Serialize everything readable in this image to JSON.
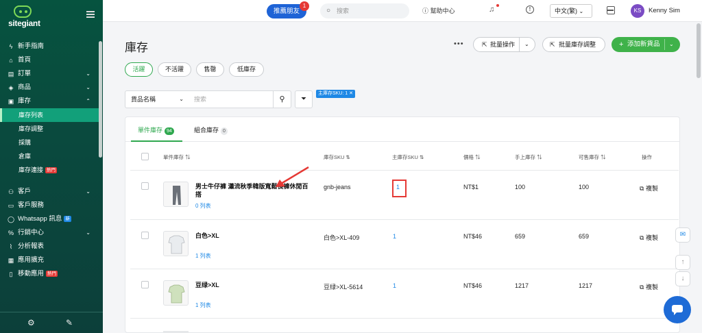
{
  "brand": {
    "name": "sitegiant"
  },
  "sidebar": {
    "items": [
      {
        "label": "新手指南",
        "icon": "bolt-icon"
      },
      {
        "label": "首頁",
        "icon": "home-icon"
      },
      {
        "label": "訂單",
        "icon": "clipboard-icon",
        "chevron": "down"
      },
      {
        "label": "商品",
        "icon": "box-icon",
        "chevron": "down"
      },
      {
        "label": "庫存",
        "icon": "inventory-icon",
        "chevron": "up"
      }
    ],
    "subitems": [
      {
        "label": "庫存列表",
        "active": true
      },
      {
        "label": "庫存調整"
      },
      {
        "label": "採購"
      },
      {
        "label": "倉庫"
      },
      {
        "label": "庫存連接",
        "badge": "熱門"
      }
    ],
    "items2": [
      {
        "label": "客戶",
        "icon": "users-icon",
        "chevron": "down"
      },
      {
        "label": "客戶服務",
        "icon": "chat-icon"
      },
      {
        "label": "Whatsapp 訊息",
        "icon": "whatsapp-icon",
        "badge": "新"
      },
      {
        "label": "行銷中心",
        "icon": "percent-icon",
        "chevron": "down"
      },
      {
        "label": "分析報表",
        "icon": "chart-icon"
      },
      {
        "label": "應用擴充",
        "icon": "apps-icon"
      },
      {
        "label": "移動應用",
        "icon": "mobile-icon",
        "badge": "熱門"
      }
    ]
  },
  "topbar": {
    "refer_label": "推薦朋友",
    "refer_badge": "1",
    "search_placeholder": "搜索",
    "help_label": "幫助中心",
    "language": "中文(繁)",
    "avatar_initials": "KS",
    "user_name": "Kenny Sim"
  },
  "page": {
    "title": "庫存",
    "bulk_action": "批量操作",
    "bulk_adjust": "批量庫存調整",
    "add_new": "添加新貨品"
  },
  "status_filters": [
    "活躍",
    "不活躍",
    "售罄",
    "低庫存"
  ],
  "filter": {
    "field": "貨品名稱",
    "search_placeholder": "搜索",
    "active_tag": "主庫存SKU: 1 ✕"
  },
  "tabs": [
    {
      "label": "單件庫存",
      "count": "94"
    },
    {
      "label": "組合庫存",
      "count": "0"
    }
  ],
  "columns": [
    "單件庫存",
    "庫存SKU",
    "主庫存SKU",
    "價格",
    "手上庫存",
    "可售庫存",
    "操作"
  ],
  "rows": [
    {
      "name": "男士牛仔褲 瀟流秋季韓版寬鬆長褲休閒百搭",
      "list": "0 列表",
      "sku": "gnb-jeans",
      "main_sku": "1",
      "price": "NT$1",
      "on_hand": "100",
      "available": "100",
      "action": "複製"
    },
    {
      "name": "白色>XL",
      "list": "1 列表",
      "sku": "白色>XL-409",
      "main_sku": "1",
      "price": "NT$46",
      "on_hand": "659",
      "available": "659",
      "action": "複製"
    },
    {
      "name": "豆绿>XL",
      "list": "1 列表",
      "sku": "豆绿>XL-5614",
      "main_sku": "1",
      "price": "NT$46",
      "on_hand": "1217",
      "available": "1217",
      "action": "複製"
    }
  ],
  "colors": {
    "accent": "#2fa84f",
    "link": "#1e88e5",
    "sidebar": "#0a4a3e",
    "highlight": "#e53935"
  }
}
